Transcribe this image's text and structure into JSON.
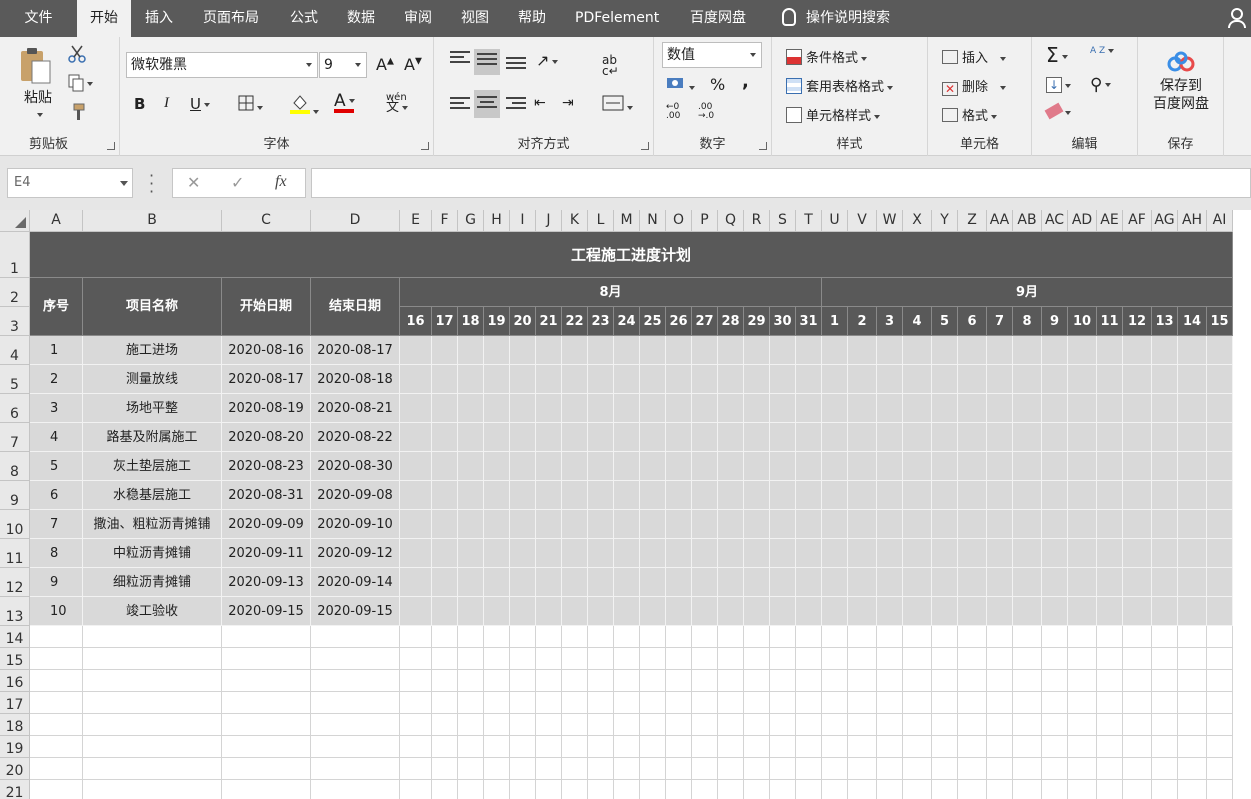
{
  "menu": {
    "tabs": [
      "文件",
      "开始",
      "插入",
      "页面布局",
      "公式",
      "数据",
      "审阅",
      "视图",
      "帮助",
      "PDFelement",
      "百度网盘"
    ],
    "active": "开始",
    "tell_me": "操作说明搜索"
  },
  "ribbon": {
    "clipboard": {
      "paste": "粘贴",
      "label": "剪贴板"
    },
    "font": {
      "name": "微软雅黑",
      "size": "9",
      "bold": "B",
      "italic": "I",
      "underline": "U",
      "grow": "A",
      "shrink": "A",
      "font_color": "A",
      "phonetic": "wén",
      "label": "字体"
    },
    "alignment": {
      "label": "对齐方式",
      "wrap": "ab"
    },
    "number": {
      "format": "数值",
      "percent": "%",
      "comma": ",",
      "label": "数字",
      "inc_dec": ".00",
      "dec_dec": ".0"
    },
    "styles": {
      "conditional": "条件格式",
      "table": "套用表格格式",
      "cell": "单元格样式",
      "label": "样式"
    },
    "cells": {
      "insert": "插入",
      "delete": "删除",
      "format": "格式",
      "label": "单元格"
    },
    "editing": {
      "sum": "Σ",
      "sort": "A Z",
      "label": "编辑"
    },
    "save": {
      "line1": "保存到",
      "line2": "百度网盘",
      "label": "保存"
    }
  },
  "formula_bar": {
    "name_box": "E4",
    "cancel": "✕",
    "enter": "✓",
    "fx": "fx",
    "value": ""
  },
  "columns": [
    "A",
    "B",
    "C",
    "D",
    "E",
    "F",
    "G",
    "H",
    "I",
    "J",
    "K",
    "L",
    "M",
    "N",
    "O",
    "P",
    "Q",
    "R",
    "S",
    "T",
    "U",
    "V",
    "W",
    "X",
    "Y",
    "Z",
    "AA",
    "AB",
    "AC",
    "AD",
    "AE",
    "AF",
    "AG",
    "AH",
    "AI"
  ],
  "rows": [
    "1",
    "2",
    "3",
    "4",
    "5",
    "6",
    "7",
    "8",
    "9",
    "10",
    "11",
    "12",
    "13",
    "14",
    "15",
    "16",
    "17",
    "18",
    "19",
    "20",
    "21"
  ],
  "sheet": {
    "title": "工程施工进度计划",
    "headers": {
      "seq": "序号",
      "name": "项目名称",
      "start": "开始日期",
      "end": "结束日期"
    },
    "months": [
      {
        "label": "8月",
        "days": [
          "16",
          "17",
          "18",
          "19",
          "20",
          "21",
          "22",
          "23",
          "24",
          "25",
          "26",
          "27",
          "28",
          "29",
          "30",
          "31"
        ]
      },
      {
        "label": "9月",
        "days": [
          "1",
          "2",
          "3",
          "4",
          "5",
          "6",
          "7",
          "8",
          "9",
          "10",
          "11",
          "12",
          "13",
          "14",
          "15"
        ]
      }
    ],
    "tasks": [
      {
        "seq": "1",
        "name": "施工进场",
        "start": "2020-08-16",
        "end": "2020-08-17"
      },
      {
        "seq": "2",
        "name": "测量放线",
        "start": "2020-08-17",
        "end": "2020-08-18"
      },
      {
        "seq": "3",
        "name": "场地平整",
        "start": "2020-08-19",
        "end": "2020-08-21"
      },
      {
        "seq": "4",
        "name": "路基及附属施工",
        "start": "2020-08-20",
        "end": "2020-08-22"
      },
      {
        "seq": "5",
        "name": "灰土垫层施工",
        "start": "2020-08-23",
        "end": "2020-08-30"
      },
      {
        "seq": "6",
        "name": "水稳基层施工",
        "start": "2020-08-31",
        "end": "2020-09-08"
      },
      {
        "seq": "7",
        "name": "撒油、粗粒沥青摊铺",
        "start": "2020-09-09",
        "end": "2020-09-10"
      },
      {
        "seq": "8",
        "name": "中粒沥青摊铺",
        "start": "2020-09-11",
        "end": "2020-09-12"
      },
      {
        "seq": "9",
        "name": "细粒沥青摊铺",
        "start": "2020-09-13",
        "end": "2020-09-14"
      },
      {
        "seq": "10",
        "name": "竣工验收",
        "start": "2020-09-15",
        "end": "2020-09-15"
      }
    ]
  },
  "colors": {
    "header_dark": "#595959",
    "body_light": "#d9d9d9",
    "menubar": "#5a5a5a"
  }
}
